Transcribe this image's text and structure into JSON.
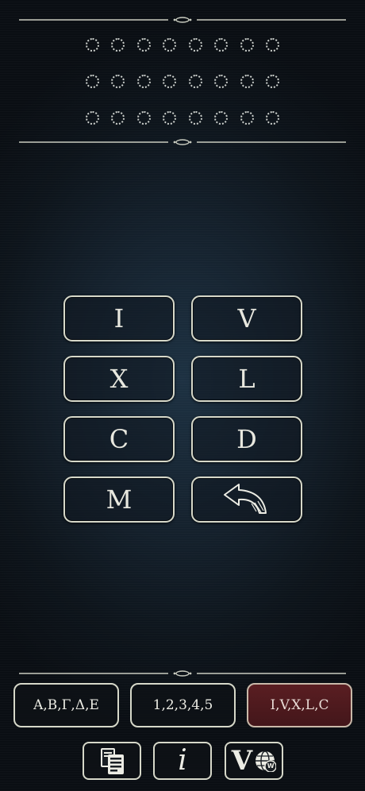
{
  "keypad": {
    "keys": [
      "I",
      "V",
      "X",
      "L",
      "C",
      "D",
      "M"
    ],
    "undo_icon": "curved-back-arrow-icon"
  },
  "modes": [
    {
      "label": "A,B,Γ,Δ,E",
      "active": false
    },
    {
      "label": "1,2,3,4,5",
      "active": false
    },
    {
      "label": "I,V,X,L,C",
      "active": true
    }
  ],
  "toolbar": {
    "copy_icon": "copy-documents-icon",
    "info_glyph": "i",
    "logo_letter": "V",
    "globe_badge_letter": "W"
  },
  "colors": {
    "accent_active": "#4e1a1e",
    "border": "#d6d8c9",
    "text": "#e8e8df"
  }
}
